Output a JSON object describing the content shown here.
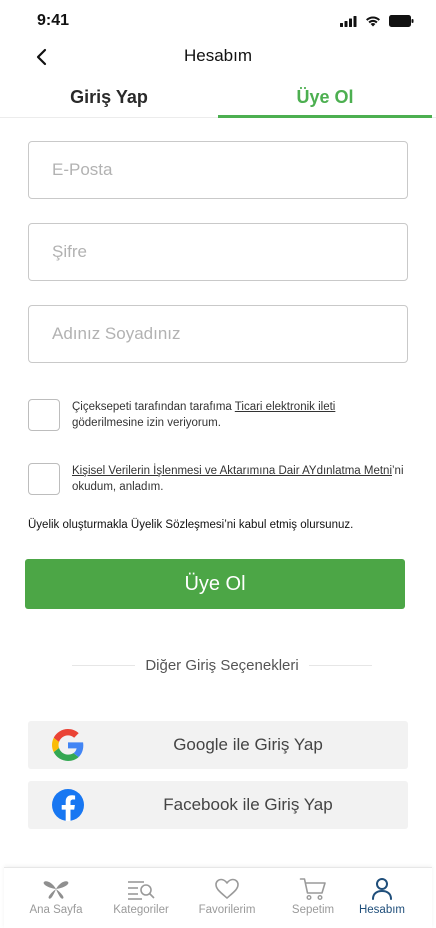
{
  "status": {
    "time": "9:41"
  },
  "header": {
    "title": "Hesabım"
  },
  "tabs": {
    "login": "Giriş Yap",
    "register": "Üye Ol"
  },
  "form": {
    "email_placeholder": "E-Posta",
    "password_placeholder": "Şifre",
    "name_placeholder": "Adınız Soyadınız"
  },
  "consents": {
    "marketing": {
      "prefix": "Çiçeksepeti tarafından tarafıma ",
      "link": "Ticari elektronik ileti",
      "suffix": " göderilmesine izin veriyorum."
    },
    "privacy": {
      "link": "Kişisel Verilerin İşlenmesi ve Aktarımına Dair AYdınlatma Metni",
      "suffix": "’ni okudum, anladım."
    }
  },
  "agreement_text": "Üyelik oluşturmakla Üyelik Sözleşmesi’ni kabul etmiş olursunuz.",
  "submit_label": "Üye Ol",
  "divider_text": "Diğer Giriş Seçenekleri",
  "social": {
    "google": "Google ile Giriş Yap",
    "facebook": "Facebook ile Giriş Yap"
  },
  "bottom_nav": [
    {
      "label": "Ana Sayfa",
      "icon": "home-icon"
    },
    {
      "label": "Kategoriler",
      "icon": "categories-icon"
    },
    {
      "label": "Favorilerim",
      "icon": "heart-icon"
    },
    {
      "label": "Sepetim",
      "icon": "cart-icon"
    },
    {
      "label": "Hesabım",
      "icon": "user-icon",
      "active": true
    }
  ],
  "colors": {
    "accent": "#4caf50",
    "button": "#4ca646",
    "active_nav": "#1f4e7a",
    "facebook": "#1877f2"
  }
}
